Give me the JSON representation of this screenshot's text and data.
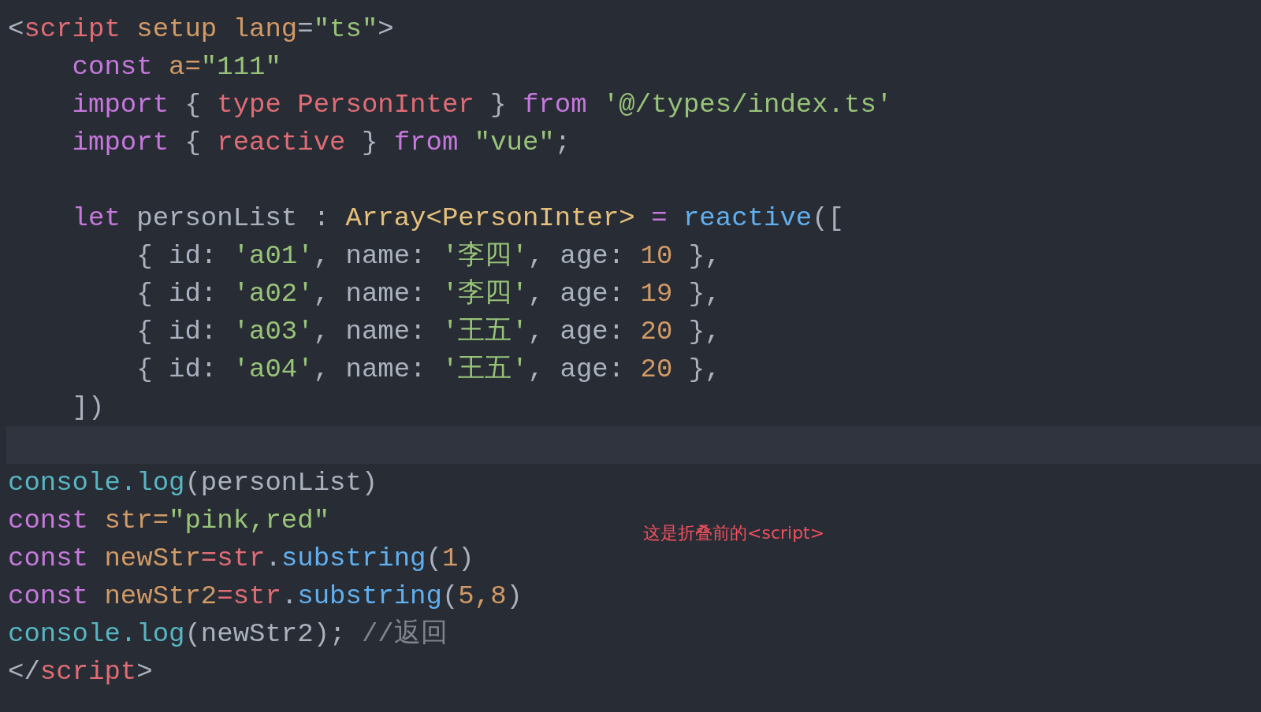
{
  "editor": {
    "lines": [
      {
        "kind": "top",
        "current": false,
        "tokens": [
          {
            "text": "<",
            "kind": "punct"
          },
          {
            "text": "script",
            "kind": "tag"
          },
          {
            "text": " setup lang",
            "kind": "attr"
          },
          {
            "text": "=",
            "kind": "punct"
          },
          {
            "text": "\"ts\"",
            "kind": "string"
          },
          {
            "text": ">",
            "kind": "punct"
          }
        ]
      },
      {
        "kind": "inner",
        "current": false,
        "tokens": [
          {
            "text": "const ",
            "kind": "keyword"
          },
          {
            "text": "a=",
            "kind": "var"
          },
          {
            "text": "\"111\"",
            "kind": "string"
          }
        ]
      },
      {
        "kind": "inner",
        "current": false,
        "tokens": [
          {
            "text": "import ",
            "kind": "keyword"
          },
          {
            "text": "{ ",
            "kind": "punct"
          },
          {
            "text": "type PersonInter ",
            "kind": "tag"
          },
          {
            "text": "} ",
            "kind": "punct"
          },
          {
            "text": "from ",
            "kind": "keyword"
          },
          {
            "text": "'@/types/index.ts'",
            "kind": "string"
          }
        ]
      },
      {
        "kind": "inner",
        "current": false,
        "tokens": [
          {
            "text": "import ",
            "kind": "keyword"
          },
          {
            "text": "{ ",
            "kind": "punct"
          },
          {
            "text": "reactive ",
            "kind": "tag"
          },
          {
            "text": "} ",
            "kind": "punct"
          },
          {
            "text": "from ",
            "kind": "keyword"
          },
          {
            "text": "\"vue\"",
            "kind": "string"
          },
          {
            "text": ";",
            "kind": "punct"
          }
        ]
      },
      {
        "kind": "blank",
        "current": false
      },
      {
        "kind": "inner",
        "current": false,
        "tokens": [
          {
            "text": "let ",
            "kind": "keyword"
          },
          {
            "text": "personList : ",
            "kind": "plain"
          },
          {
            "text": "Array<PersonInter>",
            "kind": "type"
          },
          {
            "text": " = ",
            "kind": "keyword"
          },
          {
            "text": "reactive",
            "kind": "func"
          },
          {
            "text": "([",
            "kind": "punct"
          }
        ]
      },
      {
        "kind": "nested",
        "current": false,
        "tokens": [
          {
            "text": "{ id: ",
            "kind": "plain"
          },
          {
            "text": "'a01'",
            "kind": "string"
          },
          {
            "text": ", name: ",
            "kind": "plain"
          },
          {
            "text": "'李四'",
            "kind": "string"
          },
          {
            "text": ", age: ",
            "kind": "plain"
          },
          {
            "text": "10",
            "kind": "number"
          },
          {
            "text": " },",
            "kind": "plain"
          }
        ]
      },
      {
        "kind": "nested",
        "current": false,
        "tokens": [
          {
            "text": "{ id: ",
            "kind": "plain"
          },
          {
            "text": "'a02'",
            "kind": "string"
          },
          {
            "text": ", name: ",
            "kind": "plain"
          },
          {
            "text": "'李四'",
            "kind": "string"
          },
          {
            "text": ", age: ",
            "kind": "plain"
          },
          {
            "text": "19",
            "kind": "number"
          },
          {
            "text": " },",
            "kind": "plain"
          }
        ]
      },
      {
        "kind": "nested",
        "current": false,
        "tokens": [
          {
            "text": "{ id: ",
            "kind": "plain"
          },
          {
            "text": "'a03'",
            "kind": "string"
          },
          {
            "text": ", name: ",
            "kind": "plain"
          },
          {
            "text": "'王五'",
            "kind": "string"
          },
          {
            "text": ", age: ",
            "kind": "plain"
          },
          {
            "text": "20",
            "kind": "number"
          },
          {
            "text": " },",
            "kind": "plain"
          }
        ]
      },
      {
        "kind": "nested",
        "current": false,
        "tokens": [
          {
            "text": "{ id: ",
            "kind": "plain"
          },
          {
            "text": "'a04'",
            "kind": "string"
          },
          {
            "text": ", name: ",
            "kind": "plain"
          },
          {
            "text": "'王五'",
            "kind": "string"
          },
          {
            "text": ", age: ",
            "kind": "plain"
          },
          {
            "text": "20",
            "kind": "number"
          },
          {
            "text": " },",
            "kind": "plain"
          }
        ]
      },
      {
        "kind": "inner",
        "current": false,
        "tokens": [
          {
            "text": "])",
            "kind": "plain"
          }
        ]
      },
      {
        "kind": "blank",
        "current": true
      },
      {
        "kind": "top",
        "current": false,
        "tokens": [
          {
            "text": "console.log",
            "kind": "builtin"
          },
          {
            "text": "(personList)",
            "kind": "plain"
          }
        ]
      },
      {
        "kind": "top",
        "current": false,
        "tokens": [
          {
            "text": "const ",
            "kind": "keyword"
          },
          {
            "text": "str=",
            "kind": "var"
          },
          {
            "text": "\"pink,red\"",
            "kind": "string"
          }
        ]
      },
      {
        "kind": "top",
        "current": false,
        "tokens": [
          {
            "text": "const ",
            "kind": "keyword"
          },
          {
            "text": "newStr",
            "kind": "var"
          },
          {
            "text": "=str",
            "kind": "tag"
          },
          {
            "text": ".",
            "kind": "plain"
          },
          {
            "text": "substring",
            "kind": "func"
          },
          {
            "text": "(",
            "kind": "plain"
          },
          {
            "text": "1",
            "kind": "number"
          },
          {
            "text": ")",
            "kind": "plain"
          }
        ]
      },
      {
        "kind": "top",
        "current": false,
        "tokens": [
          {
            "text": "const ",
            "kind": "keyword"
          },
          {
            "text": "newStr2",
            "kind": "var"
          },
          {
            "text": "=str",
            "kind": "tag"
          },
          {
            "text": ".",
            "kind": "plain"
          },
          {
            "text": "substring",
            "kind": "func"
          },
          {
            "text": "(",
            "kind": "plain"
          },
          {
            "text": "5,8",
            "kind": "number"
          },
          {
            "text": ")",
            "kind": "plain"
          }
        ]
      },
      {
        "kind": "top",
        "current": false,
        "tokens": [
          {
            "text": "console.log",
            "kind": "builtin"
          },
          {
            "text": "(newStr2); ",
            "kind": "plain"
          },
          {
            "text": "//返回",
            "kind": "comment"
          }
        ]
      },
      {
        "kind": "top",
        "current": false,
        "tokens": [
          {
            "text": "</",
            "kind": "punct"
          },
          {
            "text": "script",
            "kind": "tag"
          },
          {
            "text": ">",
            "kind": "punct"
          }
        ]
      }
    ]
  },
  "annotation": {
    "text": "这是折叠前的<script>"
  }
}
